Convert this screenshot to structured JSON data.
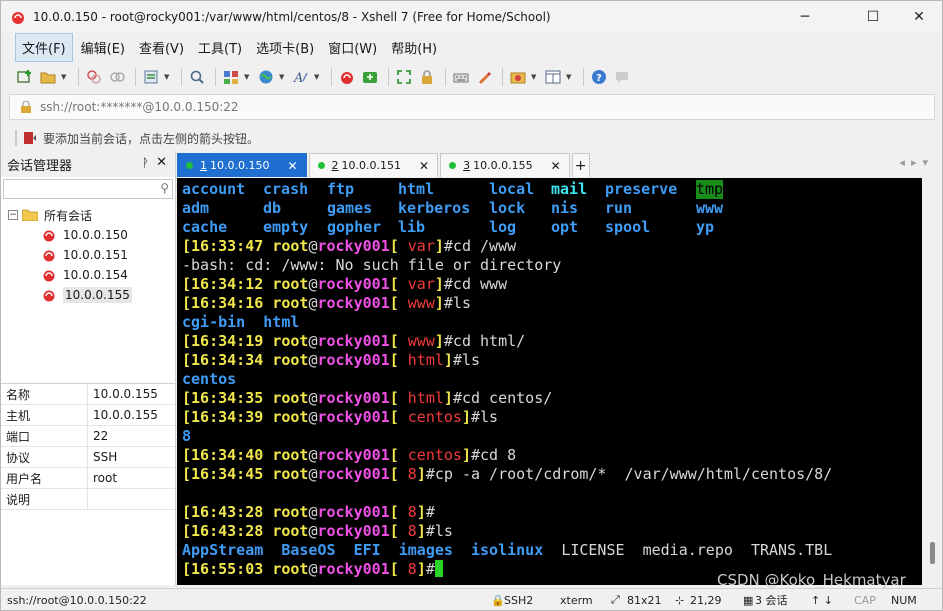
{
  "window": {
    "title": "10.0.0.150 - root@rocky001:/var/www/html/centos/8 - Xshell 7 (Free for Home/School)",
    "minimize": "─",
    "maximize": "☐",
    "close": "✕"
  },
  "menu": [
    "文件(F)",
    "编辑(E)",
    "查看(V)",
    "工具(T)",
    "选项卡(B)",
    "窗口(W)",
    "帮助(H)"
  ],
  "address": "ssh://root:*******@10.0.0.150:22",
  "hint": "要添加当前会话，点击左侧的箭头按钮。",
  "session_manager": {
    "title": "会话管理器",
    "pin": "ᚹ",
    "close": "✕",
    "root_label": "所有会话",
    "sessions": [
      "10.0.0.150",
      "10.0.0.151",
      "10.0.0.154",
      "10.0.0.155"
    ],
    "properties": [
      {
        "k": "名称",
        "v": "10.0.0.155"
      },
      {
        "k": "主机",
        "v": "10.0.0.155"
      },
      {
        "k": "端口",
        "v": "22"
      },
      {
        "k": "协议",
        "v": "SSH"
      },
      {
        "k": "用户名",
        "v": "root"
      },
      {
        "k": "说明",
        "v": ""
      }
    ]
  },
  "tabs": [
    {
      "num": "1",
      "label": "10.0.0.150",
      "active": true
    },
    {
      "num": "2",
      "label": "10.0.0.151",
      "active": false
    },
    {
      "num": "3",
      "label": "10.0.0.155",
      "active": false
    }
  ],
  "terminal": {
    "dir_listing": [
      [
        "account",
        "crash",
        "ftp",
        "html",
        "local",
        "mail",
        "preserve",
        "tmp"
      ],
      [
        "adm",
        "db",
        "games",
        "kerberos",
        "lock",
        "nis",
        "run",
        "www"
      ],
      [
        "cache",
        "empty",
        "gopher",
        "lib",
        "log",
        "opt",
        "spool",
        "yp"
      ]
    ],
    "lines": [
      {
        "time": "[16:33:47",
        "dir": "var",
        "cmd": "#cd /www"
      },
      {
        "text": "-bash: cd: /www: No such file or directory"
      },
      {
        "time": "[16:34:12",
        "dir": "var",
        "cmd": "#cd www"
      },
      {
        "time": "[16:34:16",
        "dir": "www",
        "cmd": "#ls"
      },
      {
        "items": [
          "cgi-bin",
          "html"
        ]
      },
      {
        "time": "[16:34:19",
        "dir": "www",
        "cmd": "#cd html/"
      },
      {
        "time": "[16:34:34",
        "dir": "html",
        "cmd": "#ls"
      },
      {
        "items": [
          "centos"
        ]
      },
      {
        "time": "[16:34:35",
        "dir": "html",
        "cmd": "#cd centos/"
      },
      {
        "time": "[16:34:39",
        "dir": "centos",
        "cmd": "#ls"
      },
      {
        "items": [
          "8"
        ]
      },
      {
        "time": "[16:34:40",
        "dir": "centos",
        "cmd": "#cd 8"
      },
      {
        "time": "[16:34:45",
        "dir": "8",
        "cmd": "#cp -a /root/cdrom/*  /var/www/html/centos/8/"
      },
      {
        "text": ""
      },
      {
        "time": "[16:43:28",
        "dir": "8",
        "cmd": "#"
      },
      {
        "time": "[16:43:28",
        "dir": "8",
        "cmd": "#ls"
      },
      {
        "final_listing": true
      },
      {
        "time": "[16:55:03",
        "dir": "8",
        "cmd": "#",
        "cursor": true
      }
    ],
    "user": "root",
    "at": "@",
    "host": "rocky001",
    "bracket_open": "[ ",
    "bracket_close": "]",
    "final_dirs": [
      "AppStream",
      "BaseOS",
      "EFI",
      "images",
      "isolinux"
    ],
    "final_files": [
      "LICENSE",
      "media.repo",
      "TRANS.TBL"
    ]
  },
  "status": {
    "conn": "ssh://root@10.0.0.150:22",
    "proto": "SSH2",
    "term": "xterm",
    "size": "81x21",
    "pos": "21,29",
    "sessions": "3 会话",
    "caps": "CAP",
    "num": "NUM",
    "watermark": "CSDN @Koko_Hekmatyar"
  }
}
